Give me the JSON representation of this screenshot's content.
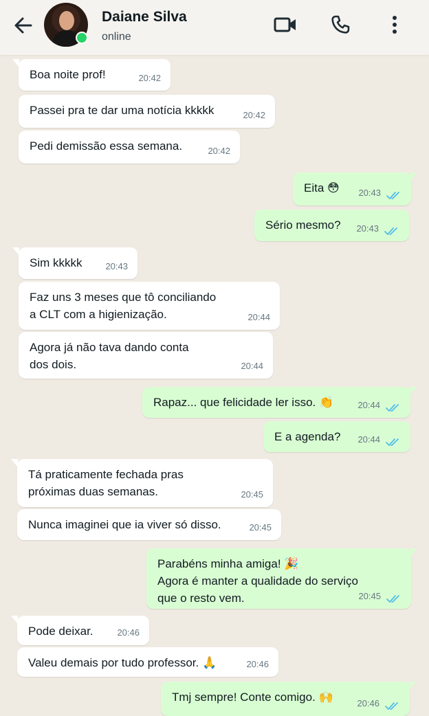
{
  "contact": {
    "name": "Daiane Silva",
    "status": "online"
  },
  "colors": {
    "incoming_bubble": "#ffffff",
    "outgoing_bubble": "#d9fdd3",
    "read_ticks": "#53bdeb",
    "online_dot": "#25d366",
    "background": "#efeae2"
  },
  "icons": {
    "back": "arrow-left-icon",
    "video": "video-camera-icon",
    "call": "phone-icon",
    "menu": "more-vertical-icon"
  },
  "messages": [
    {
      "dir": "in",
      "text": "Boa noite prof!",
      "time": "20:42"
    },
    {
      "dir": "in",
      "text": "Passei pra te dar uma notícia kkkkk",
      "time": "20:42"
    },
    {
      "dir": "in",
      "text": "Pedi demissão essa semana.",
      "time": "20:42"
    },
    {
      "dir": "out",
      "text": "Eita 😳",
      "time": "20:43",
      "status": "read"
    },
    {
      "dir": "out",
      "text": "Sério mesmo?",
      "time": "20:43",
      "status": "read"
    },
    {
      "dir": "in",
      "text": "Sim kkkkk",
      "time": "20:43"
    },
    {
      "dir": "in",
      "text": "Faz uns 3 meses que tô conciliando\na CLT com a higienização.",
      "time": "20:44"
    },
    {
      "dir": "in",
      "text": "Agora já não tava dando conta\ndos dois.",
      "time": "20:44"
    },
    {
      "dir": "out",
      "text": "Rapaz... que felicidade ler isso. 👏",
      "time": "20:44",
      "status": "read"
    },
    {
      "dir": "out",
      "text": "E a agenda?",
      "time": "20:44",
      "status": "read"
    },
    {
      "dir": "in",
      "text": "Tá praticamente fechada pras\npróximas duas semanas.",
      "time": "20:45"
    },
    {
      "dir": "in",
      "text": "Nunca imaginei que ia viver só disso.",
      "time": "20:45"
    },
    {
      "dir": "out",
      "text": "Parabéns minha amiga! 🎉\nAgora é manter a qualidade do serviço\nque o resto vem.",
      "time": "20:45",
      "status": "read"
    },
    {
      "dir": "in",
      "text": "Pode deixar.",
      "time": "20:46"
    },
    {
      "dir": "in",
      "text": "Valeu demais por tudo professor. 🙏",
      "time": "20:46"
    },
    {
      "dir": "out",
      "text": "Tmj sempre! Conte comigo. 🙌",
      "time": "20:46",
      "status": "read"
    }
  ]
}
